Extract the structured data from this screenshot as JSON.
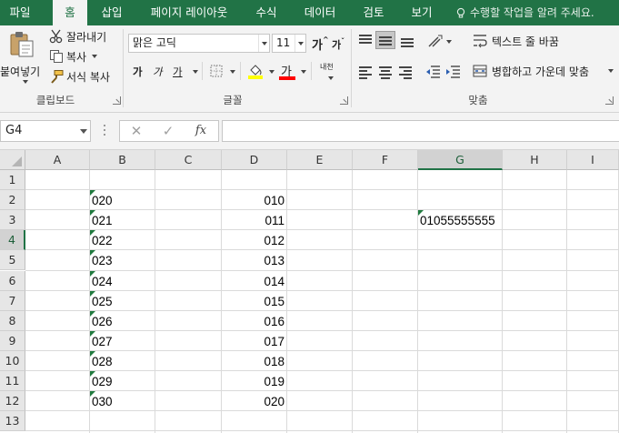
{
  "tabs": [
    {
      "label": "파일",
      "active": false
    },
    {
      "label": "홈",
      "active": true
    },
    {
      "label": "삽입",
      "active": false
    },
    {
      "label": "페이지 레이아웃",
      "active": false
    },
    {
      "label": "수식",
      "active": false
    },
    {
      "label": "데이터",
      "active": false
    },
    {
      "label": "검토",
      "active": false
    },
    {
      "label": "보기",
      "active": false
    }
  ],
  "tell_me": "수행할 작업을 알려 주세요.",
  "clipboard": {
    "paste": "붙여넣기",
    "cut": "잘라내기",
    "copy": "복사",
    "format_painter": "서식 복사",
    "group": "클립보드"
  },
  "font": {
    "name": "맑은 고딕",
    "size": "11",
    "grow": "가",
    "shrink": "가",
    "bold": "가",
    "italic": "가",
    "underline": "가",
    "color_sample": "가",
    "phonetic": "내천",
    "group": "글꼴"
  },
  "alignment": {
    "wrap_text": "텍스트 줄 바꿈",
    "merge_center": "병합하고 가운데 맞춤",
    "group": "맞춤"
  },
  "formula_bar": {
    "name_box": "G4",
    "cancel": "✕",
    "enter": "✓",
    "fx": "fx",
    "formula": ""
  },
  "grid": {
    "columns": [
      "A",
      "B",
      "C",
      "D",
      "E",
      "F",
      "G",
      "H",
      "I"
    ],
    "selected_column": "G",
    "rows": [
      "1",
      "2",
      "3",
      "4",
      "5",
      "6",
      "7",
      "8",
      "9",
      "10",
      "11",
      "12",
      "13"
    ],
    "selected_row": "4",
    "cells": {
      "B2": "020",
      "B3": "021",
      "B4": "022",
      "B5": "023",
      "B6": "024",
      "B7": "025",
      "B8": "026",
      "B9": "027",
      "B10": "028",
      "B11": "029",
      "B12": "030",
      "D2": "010",
      "D3": "011",
      "D4": "012",
      "D5": "013",
      "D6": "014",
      "D7": "015",
      "D8": "016",
      "D9": "017",
      "D10": "018",
      "D11": "019",
      "D12": "020",
      "G3": "01055555555"
    },
    "text_number_warning_cells": [
      "B2",
      "B3",
      "B4",
      "B5",
      "B6",
      "B7",
      "B8",
      "B9",
      "B10",
      "B11",
      "B12",
      "G3"
    ]
  },
  "colors": {
    "accent": "#217346",
    "font_color": "#ff0000",
    "highlight": "#ffff00",
    "warning_triangle": "#1f7a3e"
  }
}
